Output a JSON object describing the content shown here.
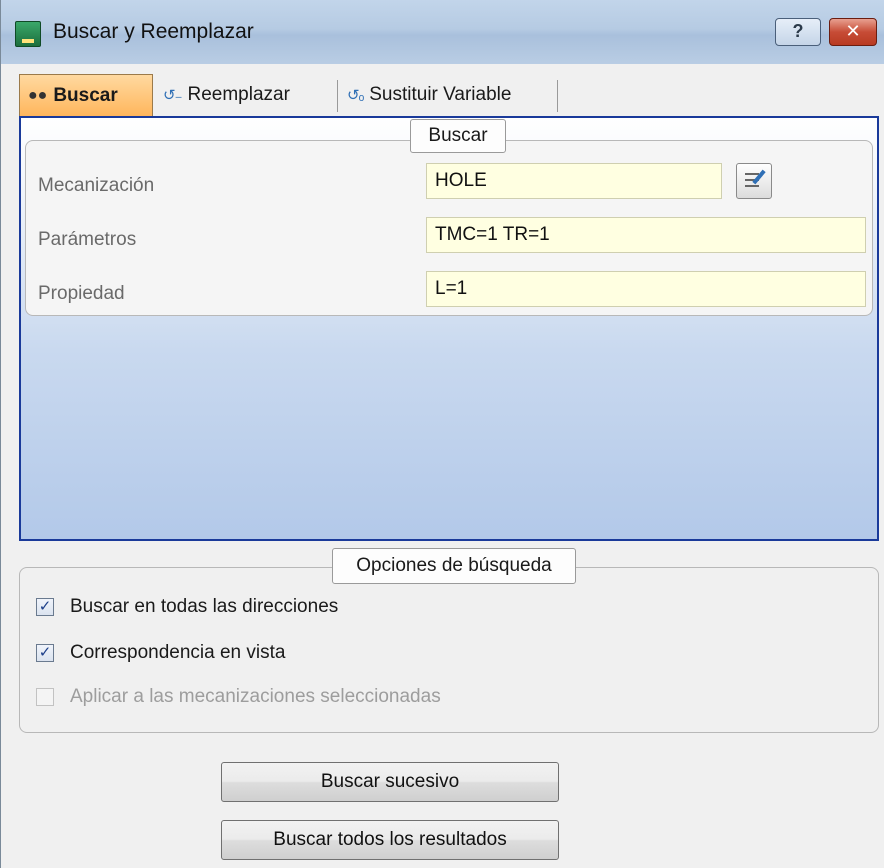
{
  "window": {
    "title": "Buscar y Reemplazar",
    "help_label": "?",
    "close_label": "✕"
  },
  "tabs": [
    {
      "label": "Buscar",
      "icon": "binoculars-icon",
      "active": true
    },
    {
      "label": "Reemplazar",
      "icon": "replace-icon",
      "active": false
    },
    {
      "label": "Sustituir Variable",
      "icon": "substitute-variable-icon",
      "active": false
    }
  ],
  "search_group": {
    "title": "Buscar",
    "fields": [
      {
        "label": "Mecanización",
        "value": "HOLE"
      },
      {
        "label": "Parámetros",
        "value": "TMC=1 TR=1"
      },
      {
        "label": "Propiedad",
        "value": "L=1"
      }
    ],
    "picker_icon": "edit-list-icon"
  },
  "options": {
    "title": "Opciones de búsqueda",
    "items": [
      {
        "label": "Buscar en todas las direcciones",
        "checked": true,
        "enabled": true
      },
      {
        "label": "Correspondencia en vista",
        "checked": true,
        "enabled": true
      },
      {
        "label": "Aplicar a las mecanizaciones seleccionadas",
        "checked": false,
        "enabled": false
      }
    ]
  },
  "buttons": {
    "find_next": "Buscar sucesivo",
    "find_all": "Buscar todos los resultados"
  },
  "colors": {
    "active_tab": "#ffb65c",
    "panel_border": "#1a3a9a",
    "field_bg": "#ffffe1"
  }
}
